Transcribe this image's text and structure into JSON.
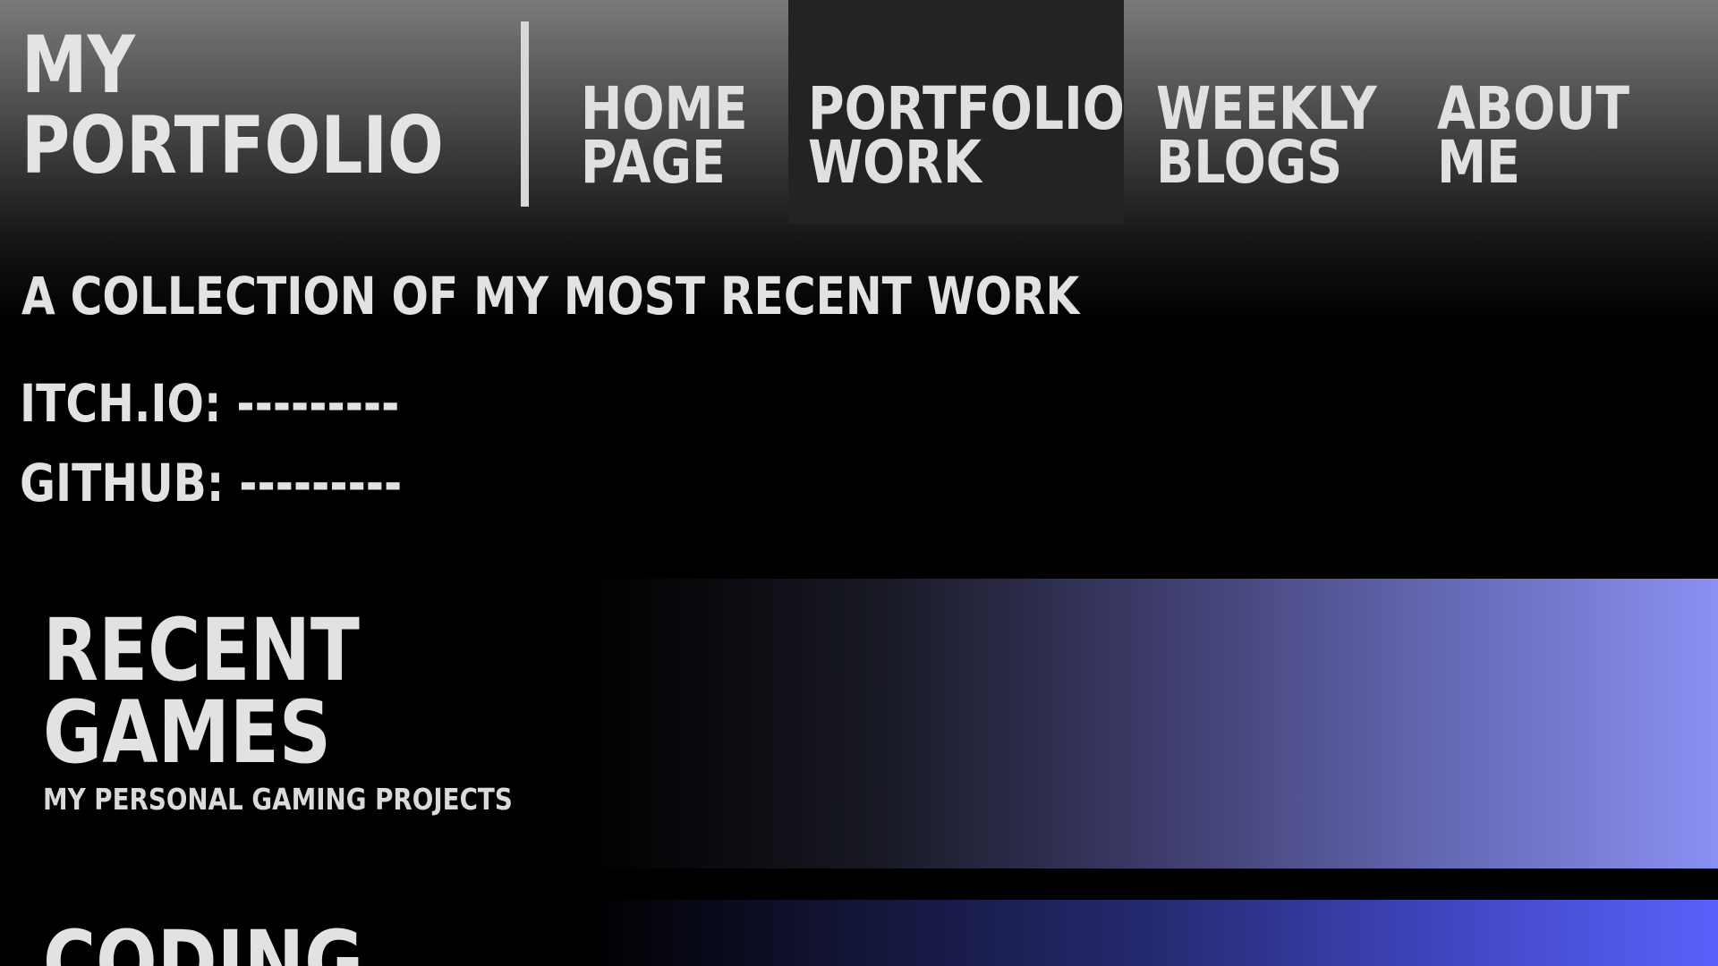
{
  "header": {
    "brand_line1": "MY",
    "brand_line2": "PORTFOLIO"
  },
  "nav": {
    "items": [
      {
        "line1": "HOME",
        "line2": "PAGE",
        "active": false
      },
      {
        "line1": "PORTFOLIO",
        "line2": "WORK",
        "active": true
      },
      {
        "line1": "WEEKLY",
        "line2": "BLOGS",
        "active": false
      },
      {
        "line1": "ABOUT",
        "line2": "ME",
        "active": false
      }
    ]
  },
  "intro": {
    "tagline": "A COLLECTION OF MY MOST RECENT WORK",
    "itch": "ITCH.IO: ---------",
    "github": "GITHUB: ---------"
  },
  "sections": [
    {
      "title_line1": "RECENT",
      "title_line2": "GAMES",
      "subtitle": "MY PERSONAL GAMING PROJECTS",
      "banner_colors": [
        "#000000",
        "#3c3b6a",
        "#8a90f2"
      ]
    },
    {
      "title_line1": "CODING",
      "banner_colors": [
        "#000000",
        "#252a70",
        "#5960fa"
      ]
    }
  ],
  "colors": {
    "text": "#e2e2e2",
    "active_nav_bg": "#232323",
    "header_top": "#7a7a7a"
  }
}
